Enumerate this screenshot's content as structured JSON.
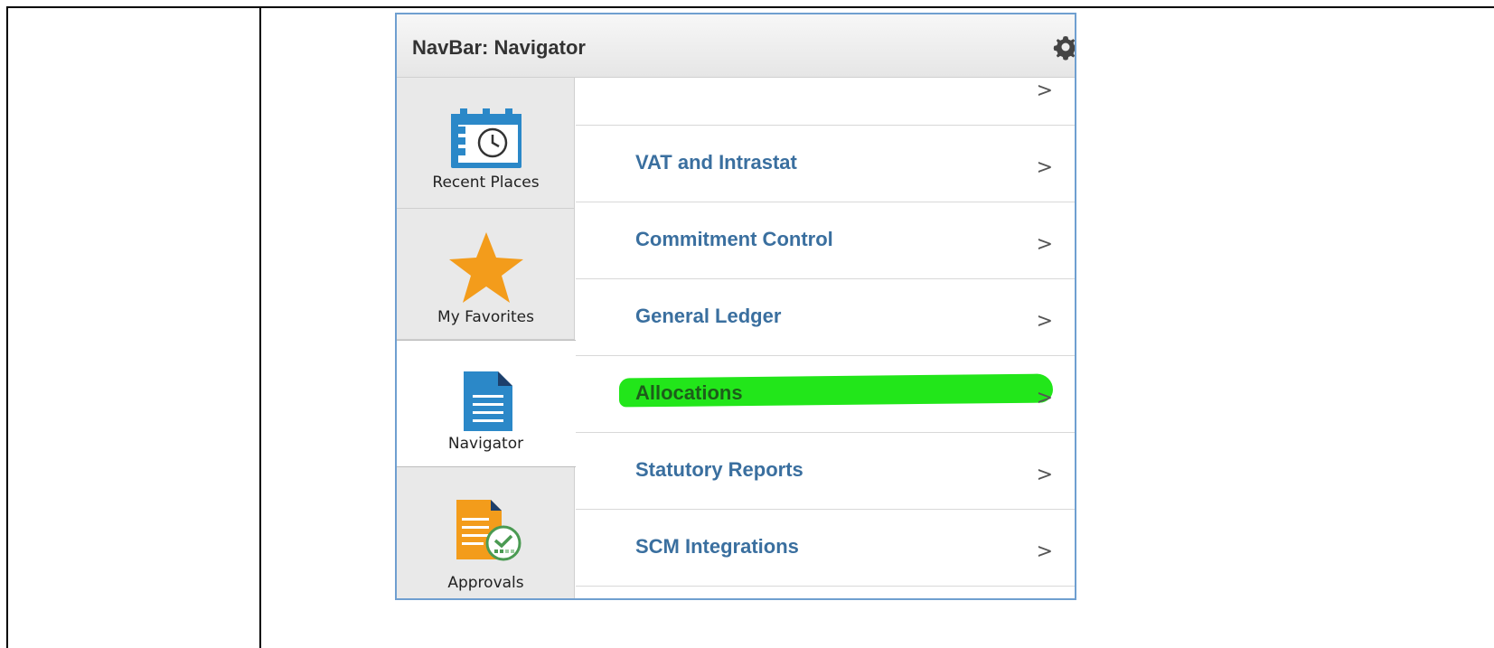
{
  "navbar": {
    "title": "NavBar: Navigator",
    "settings_icon": "gear-icon"
  },
  "tabs": [
    {
      "label": "Recent Places",
      "icon": "calendar-clock-icon"
    },
    {
      "label": "My Favorites",
      "icon": "star-icon"
    },
    {
      "label": "Navigator",
      "icon": "document-icon",
      "active": true
    },
    {
      "label": "Approvals",
      "icon": "approvals-icon"
    }
  ],
  "menu": {
    "items": [
      {
        "label": "VAT and Intrastat"
      },
      {
        "label": "Commitment Control"
      },
      {
        "label": "General Ledger"
      },
      {
        "label": "Allocations",
        "highlighted": true
      },
      {
        "label": "Statutory Reports"
      },
      {
        "label": "SCM Integrations"
      }
    ],
    "chevron": ">"
  },
  "colors": {
    "link": "#3a6f9f",
    "highlight": "#22e61a",
    "star": "#f39c1b",
    "panel_border": "#6f9fd0"
  }
}
